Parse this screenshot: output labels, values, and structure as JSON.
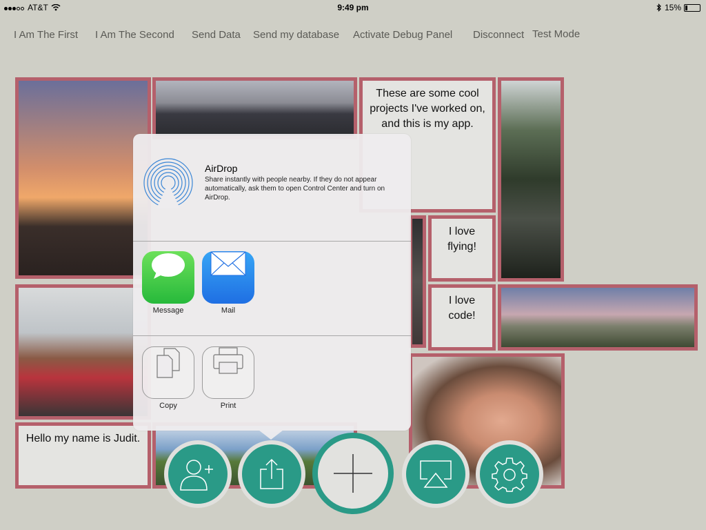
{
  "status": {
    "carrier": "AT&T",
    "time": "9:49 pm",
    "battery": "15%"
  },
  "nav": {
    "items": [
      "I Am The First",
      "I Am The Second",
      "Send Data",
      "Send my database",
      "Activate Debug Panel",
      "Disconnect",
      "Test Mode"
    ]
  },
  "tiles": {
    "cool_projects": "These are some cool projects I've worked on, and this is my app.",
    "love_flying": "I love flying!",
    "love_code": "I love code!",
    "hello": "Hello my name is Judit."
  },
  "share_sheet": {
    "airdrop_title": "AirDrop",
    "airdrop_desc": "Share instantly with people nearby. If they do not appear automatically, ask them to open Control Center and turn on AirDrop.",
    "apps": [
      {
        "label": "Message",
        "icon": "message-icon"
      },
      {
        "label": "Mail",
        "icon": "mail-icon"
      }
    ],
    "actions": [
      {
        "label": "Copy",
        "icon": "copy-icon"
      },
      {
        "label": "Print",
        "icon": "print-icon"
      }
    ]
  },
  "toolbar": {
    "buttons": [
      "add-user-icon",
      "share-icon",
      "plus-icon",
      "airplay-icon",
      "gear-icon"
    ]
  },
  "colors": {
    "accent": "#2a9a87",
    "tile_border": "#b5606b",
    "background": "#cfcfc6"
  }
}
